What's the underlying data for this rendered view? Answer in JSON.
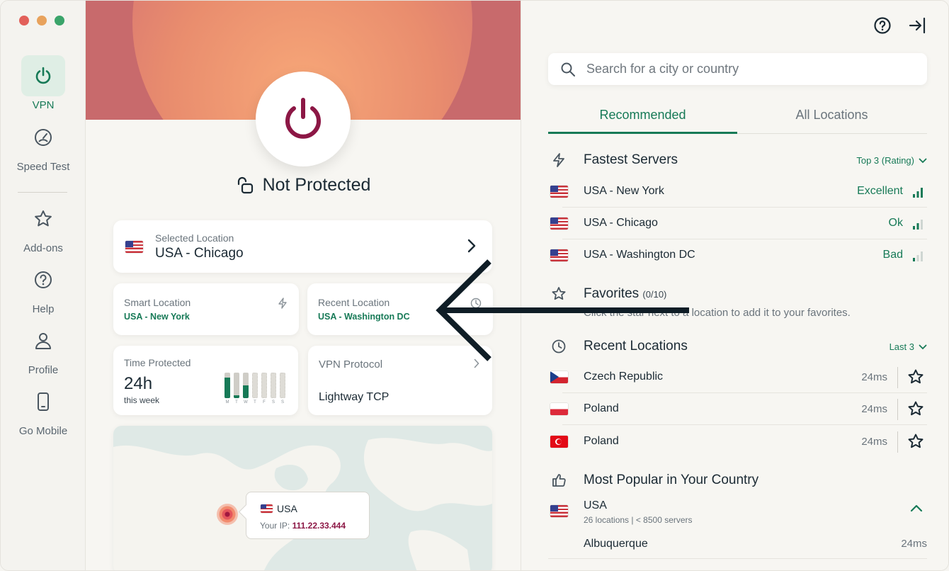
{
  "sidebar": {
    "items": [
      {
        "label": "VPN",
        "icon": "power-icon",
        "active": true
      },
      {
        "label": "Speed Test",
        "icon": "speedometer-icon"
      },
      {
        "label": "Add-ons",
        "icon": "star-icon"
      },
      {
        "label": "Help",
        "icon": "help-icon"
      },
      {
        "label": "Profile",
        "icon": "user-icon"
      },
      {
        "label": "Go Mobile",
        "icon": "mobile-icon"
      }
    ]
  },
  "main": {
    "status": "Not Protected",
    "selected_location": {
      "label": "Selected Location",
      "value": "USA - Chicago"
    },
    "smart_location": {
      "label": "Smart Location",
      "value": "USA - New York"
    },
    "recent_location": {
      "label": "Recent Location",
      "value": "USA - Washington DC"
    },
    "time_protected": {
      "label": "Time Protected",
      "value": "24h",
      "sub": "this week",
      "days": [
        "M",
        "T",
        "W",
        "T",
        "F",
        "S",
        "S"
      ],
      "levels": [
        0.8,
        0.1,
        0.5,
        0,
        0,
        0,
        0
      ]
    },
    "vpn_protocol": {
      "label": "VPN Protocol",
      "value": "Lightway TCP"
    },
    "map_tip": {
      "country": "USA",
      "ip_label": "Your IP:",
      "ip_value": "111.22.33.444"
    }
  },
  "right": {
    "search": {
      "placeholder": "Search for a city or country"
    },
    "tabs": [
      "Recommended",
      "All Locations"
    ],
    "fastest": {
      "title": "Fastest Servers",
      "filter": "Top 3 (Rating)",
      "rows": [
        {
          "name": "USA - New York",
          "quality": "Excellent",
          "bars": 3
        },
        {
          "name": "USA - Chicago",
          "quality": "Ok",
          "bars": 2
        },
        {
          "name": "USA - Washington DC",
          "quality": "Bad",
          "bars": 1
        }
      ]
    },
    "favorites": {
      "title": "Favorites",
      "count": "(0/10)",
      "desc": "Click the star next to a location to add it to your favorites."
    },
    "recent": {
      "title": "Recent Locations",
      "filter": "Last 3",
      "rows": [
        {
          "name": "Czech Republic",
          "ms": "24ms",
          "flag": "cz"
        },
        {
          "name": "Poland",
          "ms": "24ms",
          "flag": "pl"
        },
        {
          "name": "Poland",
          "ms": "24ms",
          "flag": "tr"
        }
      ]
    },
    "popular": {
      "title": "Most Popular in Your Country",
      "country": "USA",
      "sub": "26 locations | < 8500 servers",
      "city": "Albuquerque",
      "city_ms": "24ms"
    }
  },
  "colors": {
    "accent": "#177a57",
    "brand": "#8c1745",
    "hero": "#c86a6c"
  }
}
